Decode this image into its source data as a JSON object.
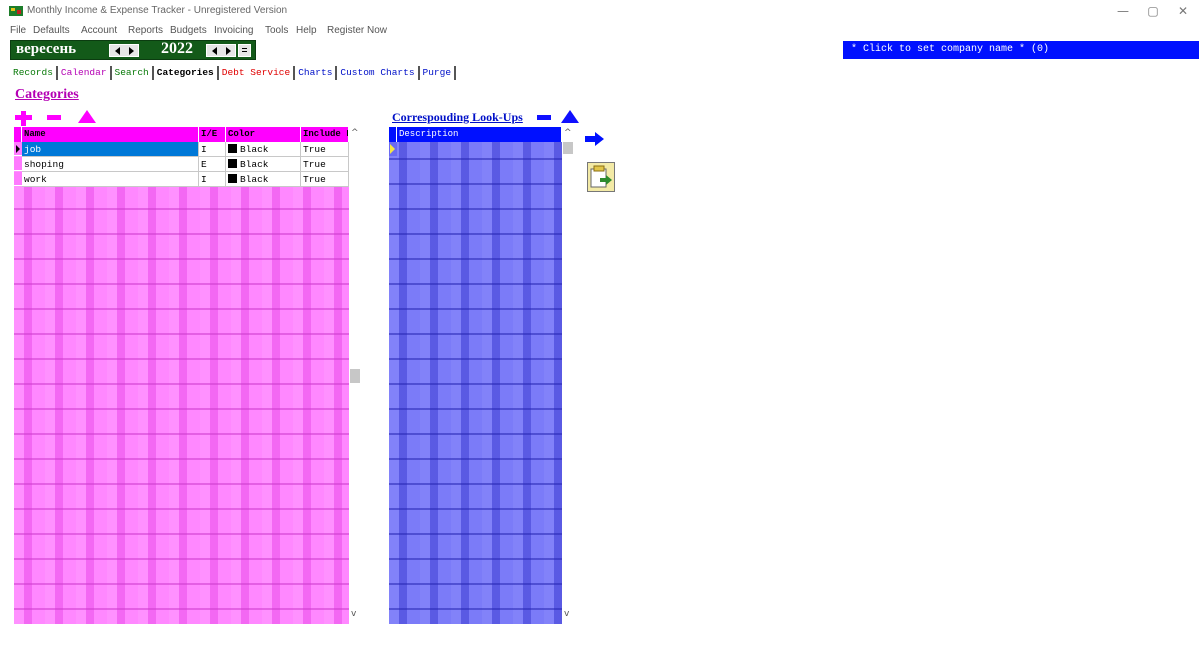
{
  "window": {
    "title": "Monthly Income & Expense Tracker - Unregistered Version",
    "minimize_glyph": "—",
    "maximize_glyph": "▢",
    "close_glyph": "✕"
  },
  "menu": [
    "File",
    "Defaults",
    "Account",
    "Reports",
    "Budgets",
    "Invoicing",
    "Tools",
    "Help",
    "Register Now"
  ],
  "period": {
    "month": "вересень",
    "year": "2022"
  },
  "company": {
    "text": "* Click to set company name * (0)"
  },
  "tabs": [
    {
      "label": "Records",
      "color": "#0a7a0a"
    },
    {
      "label": "Calendar",
      "color": "#b400b4"
    },
    {
      "label": "Search",
      "color": "#0a7a0a"
    },
    {
      "label": "Categories",
      "color": "#000000",
      "active": true
    },
    {
      "label": "Debt Service",
      "color": "#e00000"
    },
    {
      "label": "Charts",
      "color": "#0010c8"
    },
    {
      "label": "Custom Charts",
      "color": "#0010c8"
    },
    {
      "label": "Purge",
      "color": "#0010c8"
    }
  ],
  "categories": {
    "heading": "Categories",
    "columns": [
      "Name",
      "I/E",
      "Color",
      "Include F"
    ],
    "rows": [
      {
        "name": "job",
        "ie": "I",
        "color": "Black",
        "include": "True",
        "selected": true
      },
      {
        "name": "shoping",
        "ie": "E",
        "color": "Black",
        "include": "True"
      },
      {
        "name": "work",
        "ie": "I",
        "color": "Black",
        "include": "True"
      }
    ]
  },
  "lookups": {
    "heading": "Correspouding Look-Ups",
    "columns": [
      "Description"
    ]
  },
  "icons": {
    "add": "plus-icon",
    "delete": "minus-icon",
    "edit": "triangle-up-icon",
    "move": "arrow-right-icon",
    "export": "export-icon",
    "scroll_up": "^",
    "scroll_down": "v"
  },
  "colors": {
    "period_bar": "#135a19",
    "company_bar": "#0010ff",
    "category_accent": "#ff00ff",
    "lookup_accent": "#0010ff",
    "selection": "#0078d7"
  }
}
